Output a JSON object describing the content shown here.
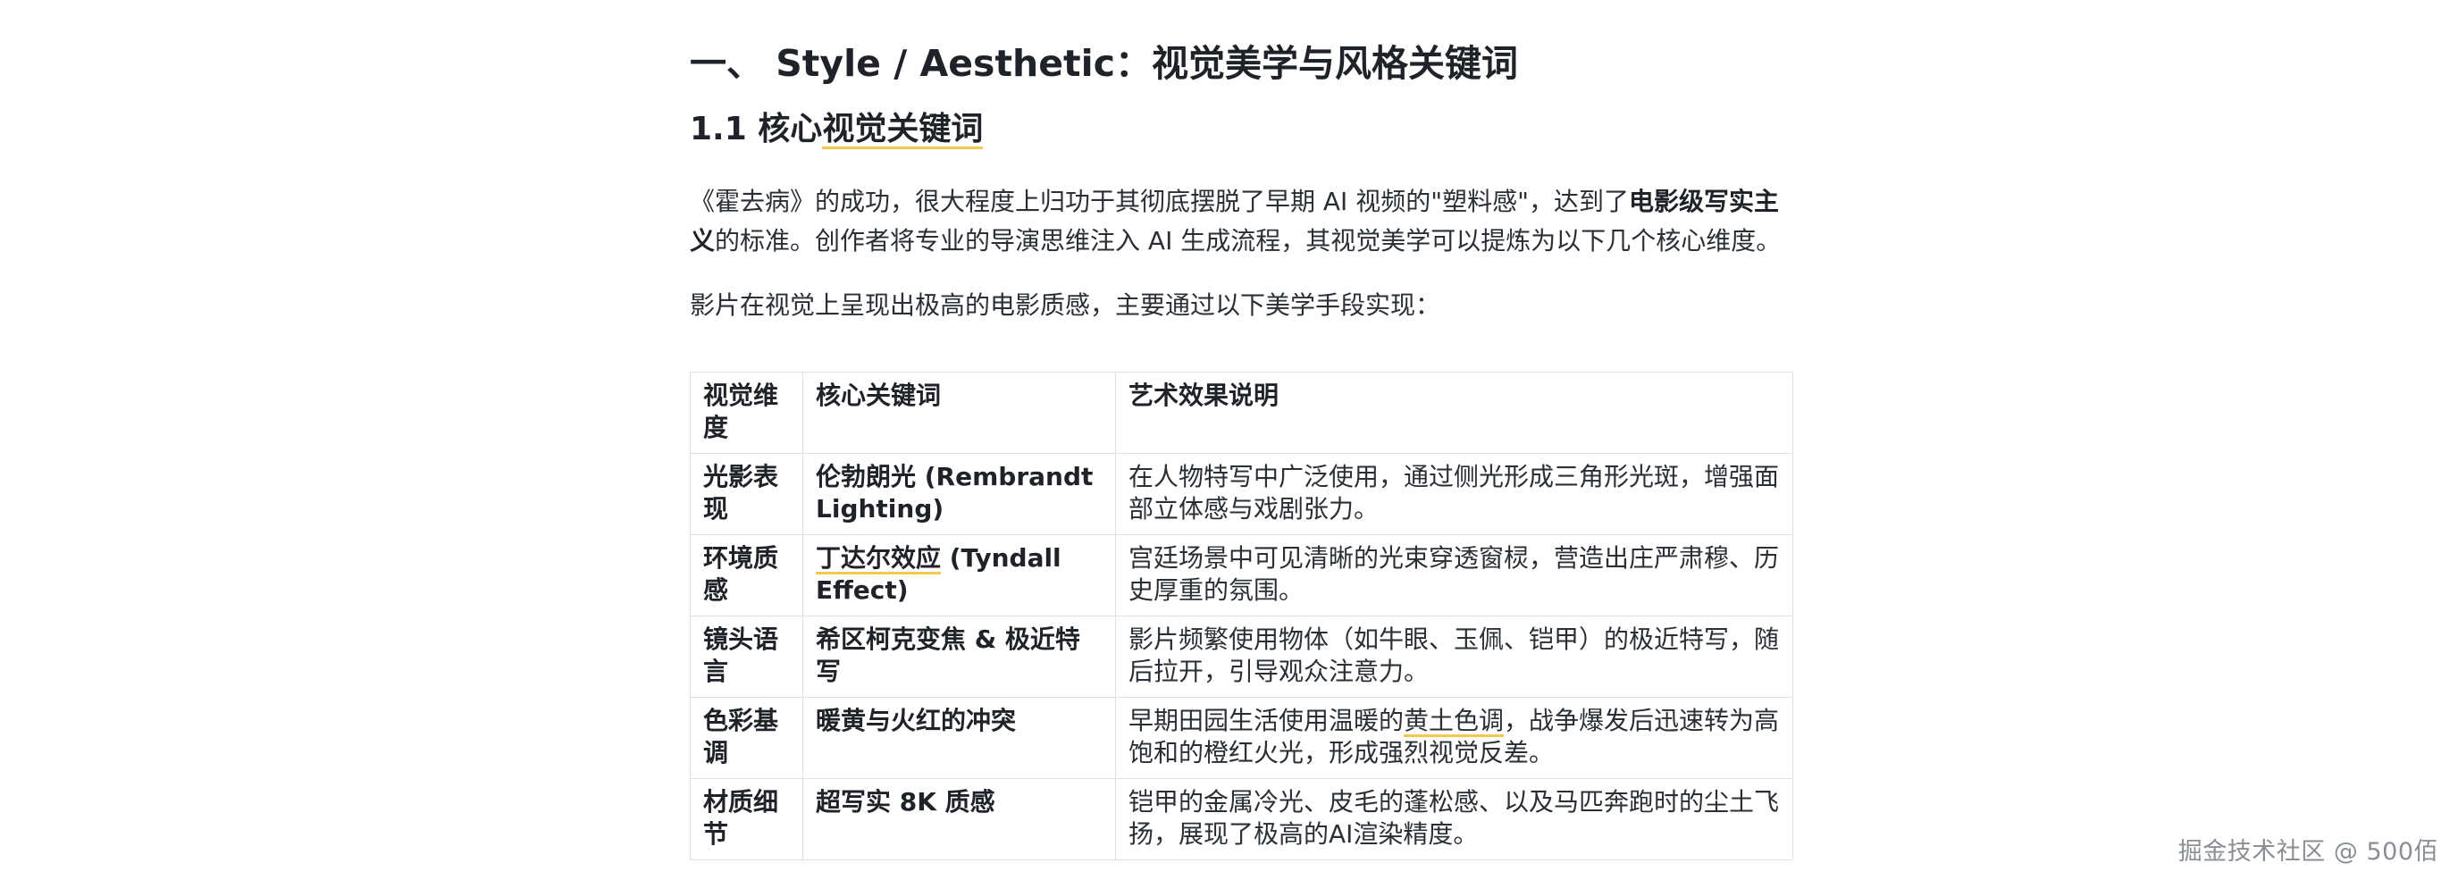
{
  "heading1": "一、 Style / Aesthetic：视觉美学与风格关键词",
  "heading2": {
    "prefix": "1.1 核心",
    "highlight": "视觉关键词"
  },
  "intro": {
    "part1": "《霍去病》的成功，很大程度上归功于其彻底摆脱了早期 AI 视频的\"塑料感\"，达到了",
    "bold": "电影级写实主义",
    "part2": "的标准。创作者将专业的导演思维注入 AI 生成流程，其视觉美学可以提炼为以下几个核心维度。"
  },
  "lead": "影片在视觉上呈现出极高的电影质感，主要通过以下美学手段实现：",
  "table": {
    "headers": [
      "视觉维度",
      "核心关键词",
      "艺术效果说明"
    ],
    "rows": [
      {
        "dimension": "光影表现",
        "keyword": "伦勃朗光 (Rembrandt Lighting)",
        "effect": "在人物特写中广泛使用，通过侧光形成三角形光斑，增强面部立体感与戏剧张力。"
      },
      {
        "dimension": "环境质感",
        "keyword_highlight": "丁达尔效应",
        "keyword_rest": " (Tyndall Effect)",
        "effect": "宫廷场景中可见清晰的光束穿透窗棂，营造出庄严肃穆、历史厚重的氛围。"
      },
      {
        "dimension": "镜头语言",
        "keyword": "希区柯克变焦 & 极近特写",
        "effect": "影片频繁使用物体（如牛眼、玉佩、铠甲）的极近特写，随后拉开，引导观众注意力。"
      },
      {
        "dimension": "色彩基调",
        "keyword": "暖黄与火红的冲突",
        "effect_before": "早期田园生活使用温暖的",
        "effect_highlight": "黄土色调",
        "effect_after": "，战争爆发后迅速转为高饱和的橙红火光，形成强烈视觉反差。"
      },
      {
        "dimension": "材质细节",
        "keyword": "超写实 8K 质感",
        "effect": "铠甲的金属冷光、皮毛的蓬松感、以及马匹奔跑时的尘土飞扬，展现了极高的AI渲染精度。"
      }
    ]
  },
  "watermark": "掘金技术社区 @ 500佰",
  "colors": {
    "text": "#1f2329",
    "highlight_underline": "#f2c94c",
    "table_border": "#dee0e3",
    "watermark": "#8a8f96"
  }
}
